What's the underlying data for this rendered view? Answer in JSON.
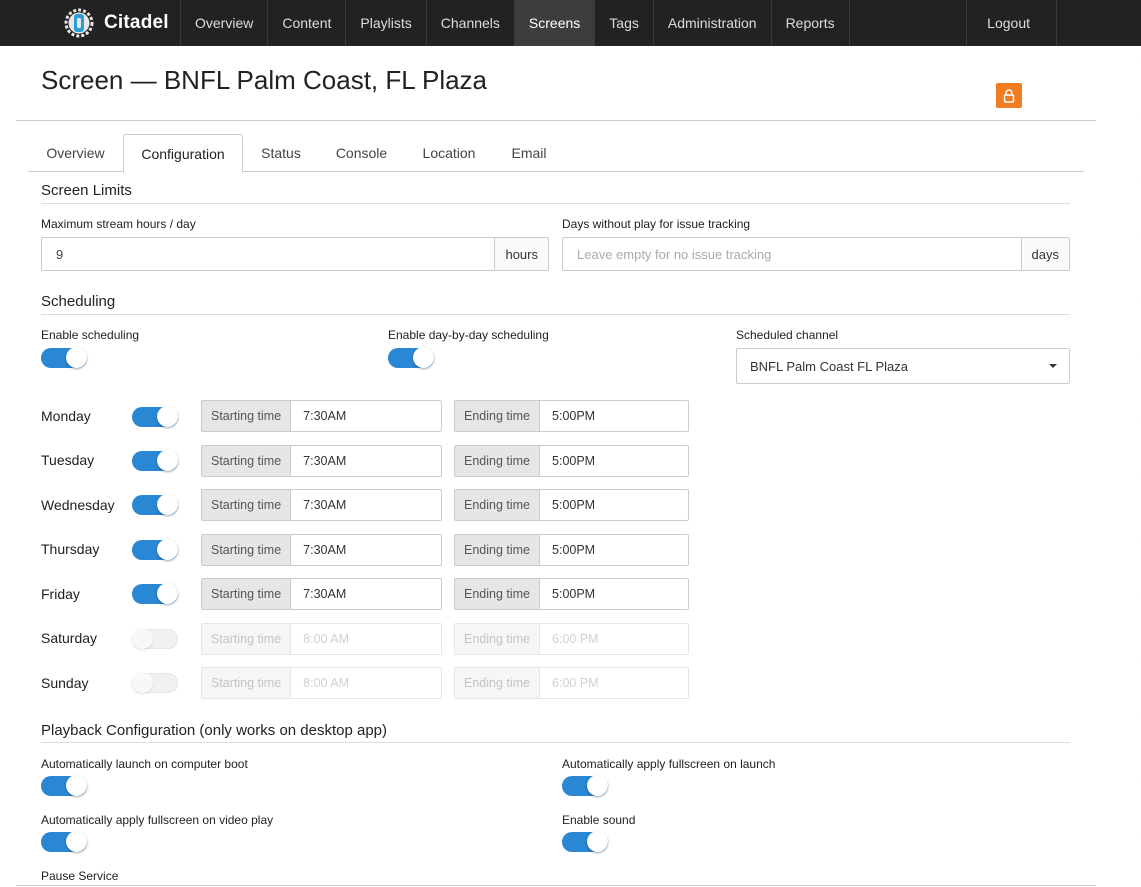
{
  "app": {
    "brand": "Citadel"
  },
  "nav": {
    "items": [
      {
        "label": "Overview"
      },
      {
        "label": "Content"
      },
      {
        "label": "Playlists"
      },
      {
        "label": "Channels"
      },
      {
        "label": "Screens",
        "active": true
      },
      {
        "label": "Tags"
      },
      {
        "label": "Administration"
      },
      {
        "label": "Reports"
      }
    ],
    "logout": "Logout"
  },
  "page": {
    "title": "Screen — BNFL Palm Coast, FL Plaza",
    "lock_icon": "lock-icon",
    "lock_color": "#f07d22"
  },
  "tabs": [
    {
      "label": "Overview"
    },
    {
      "label": "Configuration",
      "active": true
    },
    {
      "label": "Status"
    },
    {
      "label": "Console"
    },
    {
      "label": "Location"
    },
    {
      "label": "Email"
    }
  ],
  "screen_limits": {
    "title": "Screen Limits",
    "max_hours_label": "Maximum stream hours / day",
    "max_hours_value": "9",
    "max_hours_unit": "hours",
    "days_label": "Days without play for issue tracking",
    "days_placeholder": "Leave empty for no issue tracking",
    "days_unit": "days"
  },
  "scheduling": {
    "title": "Scheduling",
    "enable_label": "Enable scheduling",
    "enable_on": true,
    "daybyday_label": "Enable day-by-day scheduling",
    "daybyday_on": true,
    "channel_label": "Scheduled channel",
    "channel_value": "BNFL Palm Coast FL Plaza",
    "days": [
      {
        "day": "Monday",
        "on": true,
        "start_label": "Starting time",
        "start": "7:30AM",
        "end_label": "Ending time",
        "end": "5:00PM"
      },
      {
        "day": "Tuesday",
        "on": true,
        "start_label": "Starting time",
        "start": "7:30AM",
        "end_label": "Ending time",
        "end": "5:00PM"
      },
      {
        "day": "Wednesday",
        "on": true,
        "start_label": "Starting time",
        "start": "7:30AM",
        "end_label": "Ending time",
        "end": "5:00PM"
      },
      {
        "day": "Thursday",
        "on": true,
        "start_label": "Starting time",
        "start": "7:30AM",
        "end_label": "Ending time",
        "end": "5:00PM"
      },
      {
        "day": "Friday",
        "on": true,
        "start_label": "Starting time",
        "start": "7:30AM",
        "end_label": "Ending time",
        "end": "5:00PM"
      },
      {
        "day": "Saturday",
        "on": false,
        "start_label": "Starting time",
        "start": "8:00 AM",
        "end_label": "Ending time",
        "end": "6:00 PM"
      },
      {
        "day": "Sunday",
        "on": false,
        "start_label": "Starting time",
        "start": "8:00 AM",
        "end_label": "Ending time",
        "end": "6:00 PM"
      }
    ]
  },
  "playback": {
    "title": "Playback Configuration (only works on desktop app)",
    "auto_launch_label": "Automatically launch on computer boot",
    "auto_launch_on": true,
    "fullscreen_launch_label": "Automatically apply fullscreen on launch",
    "fullscreen_launch_on": true,
    "fullscreen_video_label": "Automatically apply fullscreen on video play",
    "fullscreen_video_on": true,
    "sound_label": "Enable sound",
    "sound_on": true,
    "pause_label": "Pause Service"
  },
  "colors": {
    "accent": "#2a87d3",
    "nav_bg": "#222222",
    "lock": "#f07d22"
  }
}
